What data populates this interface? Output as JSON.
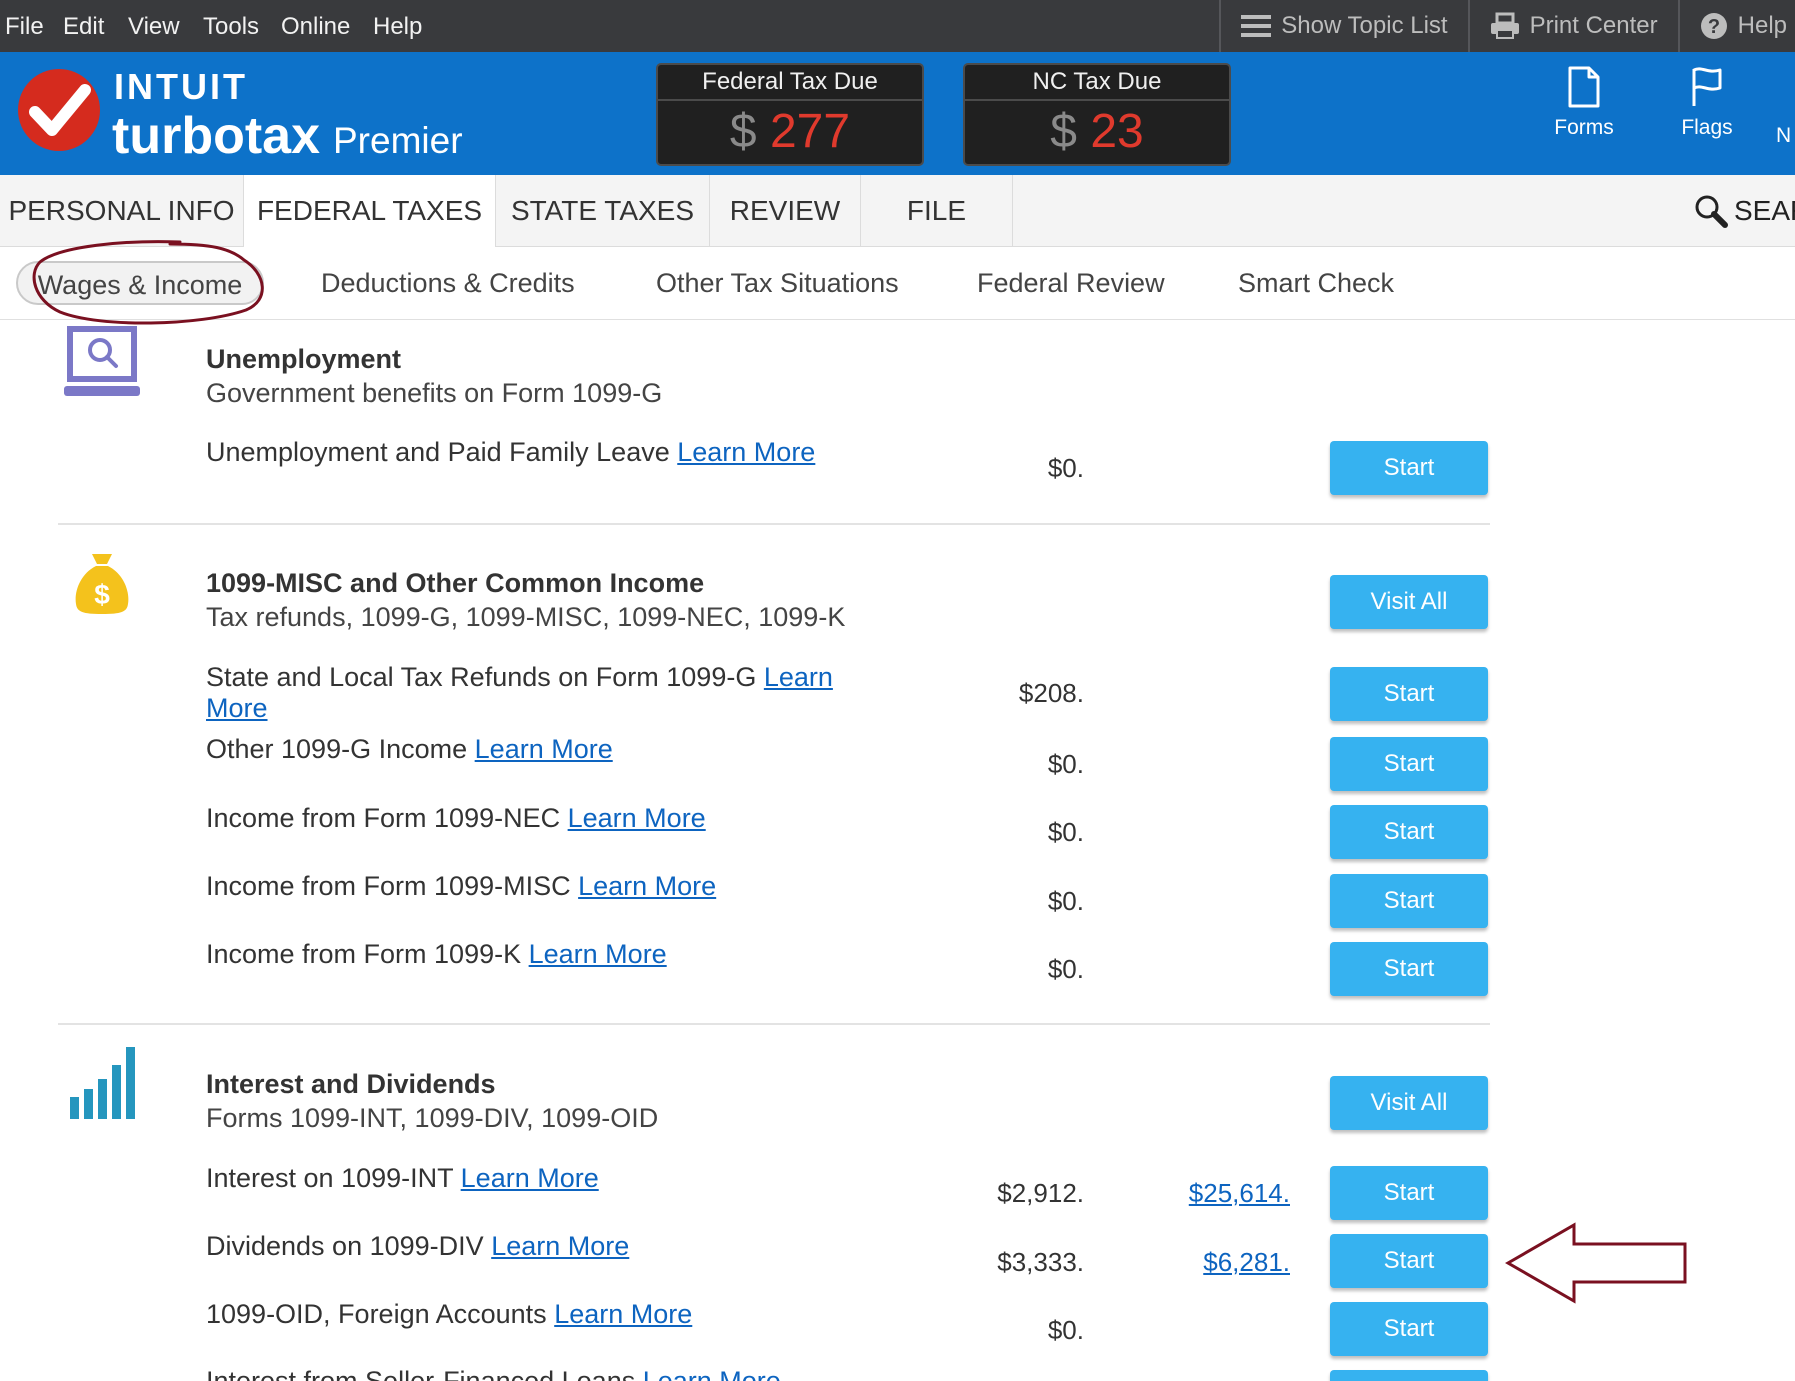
{
  "menubar": {
    "items": [
      "File",
      "Edit",
      "View",
      "Tools",
      "Online",
      "Help"
    ],
    "tools": {
      "topic_list": "Show Topic List",
      "print_center": "Print Center",
      "help": "Help"
    }
  },
  "header": {
    "brand_intuit": "INTUIT",
    "brand_turbotax": "turbotax",
    "brand_edition": "Premier",
    "federal": {
      "label": "Federal Tax Due",
      "currency": "$",
      "amount": "277"
    },
    "state": {
      "label": "NC Tax Due",
      "currency": "$",
      "amount": "23"
    },
    "buttons": {
      "forms": "Forms",
      "flags": "Flags",
      "partial": "N"
    },
    "colors": {
      "header_bg": "#0d72c9",
      "tax_amount": "#e03a2d",
      "button_bg": "#36b2f0"
    }
  },
  "main_tabs": {
    "personal": "PERSONAL INFO",
    "federal": "FEDERAL TAXES",
    "state": "STATE TAXES",
    "review": "REVIEW",
    "file": "FILE",
    "search": "SEAR"
  },
  "sub_tabs": {
    "wages": "Wages & Income",
    "deductions": "Deductions & Credits",
    "other": "Other Tax Situations",
    "federal_review": "Federal Review",
    "smart_check": "Smart Check"
  },
  "learn_more": "Learn More",
  "learn": "Learn",
  "more": "More",
  "start_label": "Start",
  "visit_all_label": "Visit All",
  "sections": {
    "unemployment": {
      "title": "Unemployment",
      "subtitle": "Government benefits on Form 1099-G",
      "rows": [
        {
          "label": "Unemployment and Paid Family Leave",
          "amount": "$0."
        }
      ]
    },
    "misc": {
      "title": "1099-MISC and Other Common Income",
      "subtitle": "Tax refunds, 1099-G, 1099-MISC, 1099-NEC, 1099-K",
      "rows": [
        {
          "label": "State and Local Tax Refunds on Form 1099-G",
          "amount": "$208."
        },
        {
          "label": "Other 1099-G Income",
          "amount": "$0."
        },
        {
          "label": "Income from Form 1099-NEC",
          "amount": "$0."
        },
        {
          "label": "Income from Form 1099-MISC",
          "amount": "$0."
        },
        {
          "label": "Income from Form 1099-K",
          "amount": "$0."
        }
      ]
    },
    "interest": {
      "title": "Interest and Dividends",
      "subtitle": "Forms 1099-INT, 1099-DIV, 1099-OID",
      "rows": [
        {
          "label": "Interest on 1099-INT",
          "amount": "$2,912.",
          "amount2": "$25,614."
        },
        {
          "label": "Dividends on 1099-DIV",
          "amount": "$3,333.",
          "amount2": "$6,281."
        },
        {
          "label": "1099-OID, Foreign Accounts",
          "amount": "$0."
        },
        {
          "label": "Interest from Seller-Financed Loans"
        }
      ]
    }
  }
}
